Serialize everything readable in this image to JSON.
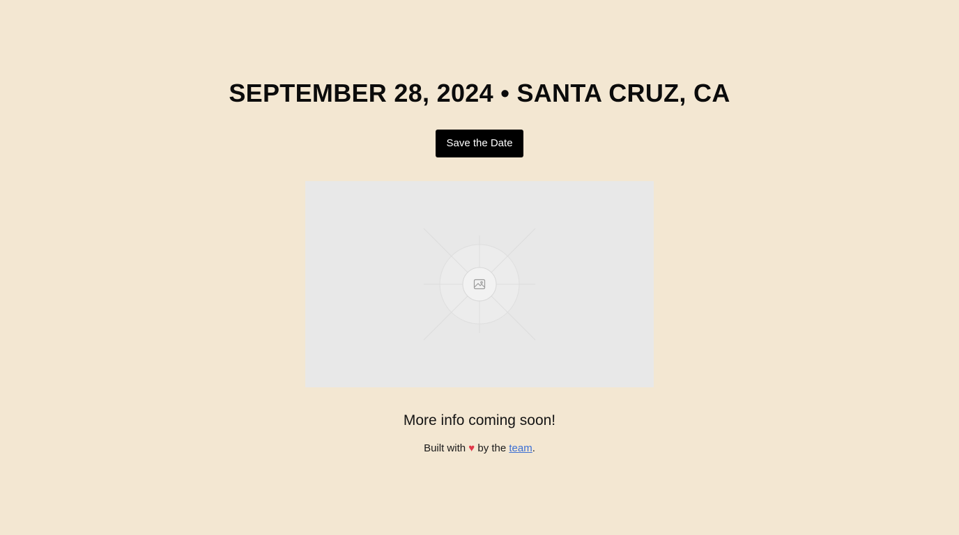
{
  "hero": {
    "headline": "SEPTEMBER 28, 2024 • SANTA CRUZ, CA",
    "save_button_label": "Save the Date"
  },
  "image": {
    "icon": "image-icon",
    "placeholder_color": "#e8e8e8"
  },
  "info": {
    "tagline": "More info coming soon!"
  },
  "footer": {
    "prefix": "Built with ",
    "heart_icon": "heart-icon",
    "heart": "♥",
    "middle": " by the ",
    "link_label": "team",
    "suffix": "."
  },
  "colors": {
    "background": "#f3e7d2",
    "button": "#000000",
    "heart": "#e0394a",
    "link": "#3b6fd4"
  }
}
